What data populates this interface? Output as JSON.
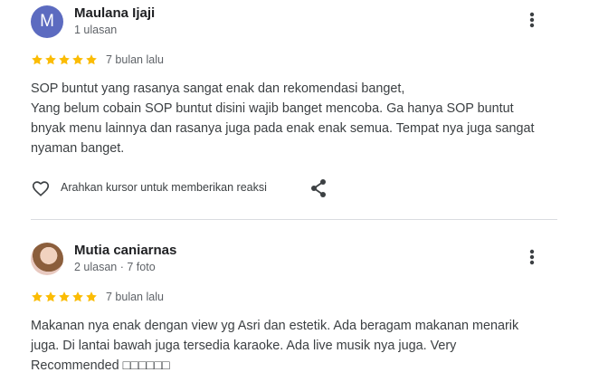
{
  "reviews": [
    {
      "author": "Maulana Ijaji",
      "avatar_letter": "M",
      "meta": "1 ulasan",
      "stars": 5,
      "time": "7 bulan lalu",
      "text_lines": [
        "SOP buntut yang rasanya sangat enak dan rekomendasi banget,",
        "Yang belum cobain SOP buntut disini wajib banget mencoba. Ga hanya SOP buntut bnyak menu lainnya dan rasanya juga pada enak enak semua. Tempat nya juga sangat nyaman banget."
      ],
      "reaction_label": "Arahkan kursor untuk memberikan reaksi"
    },
    {
      "author": "Mutia caniarnas",
      "meta": "2 ulasan · 7 foto",
      "stars": 5,
      "time": "7 bulan lalu",
      "text_lines": [
        "Makanan nya enak dengan view yg Asri dan estetik. Ada beragam makanan menarik juga. Di lantai bawah juga tersedia karaoke. Ada live musik nya juga. Very Recommended □□□□□□"
      ]
    }
  ],
  "colors": {
    "star": "#fbbc04",
    "avatar_letter_bg": "#5c6bc0",
    "divider": "#dadce0"
  },
  "icons": [
    "more-vert-icon",
    "star-icon",
    "heart-outline-icon",
    "share-icon"
  ]
}
